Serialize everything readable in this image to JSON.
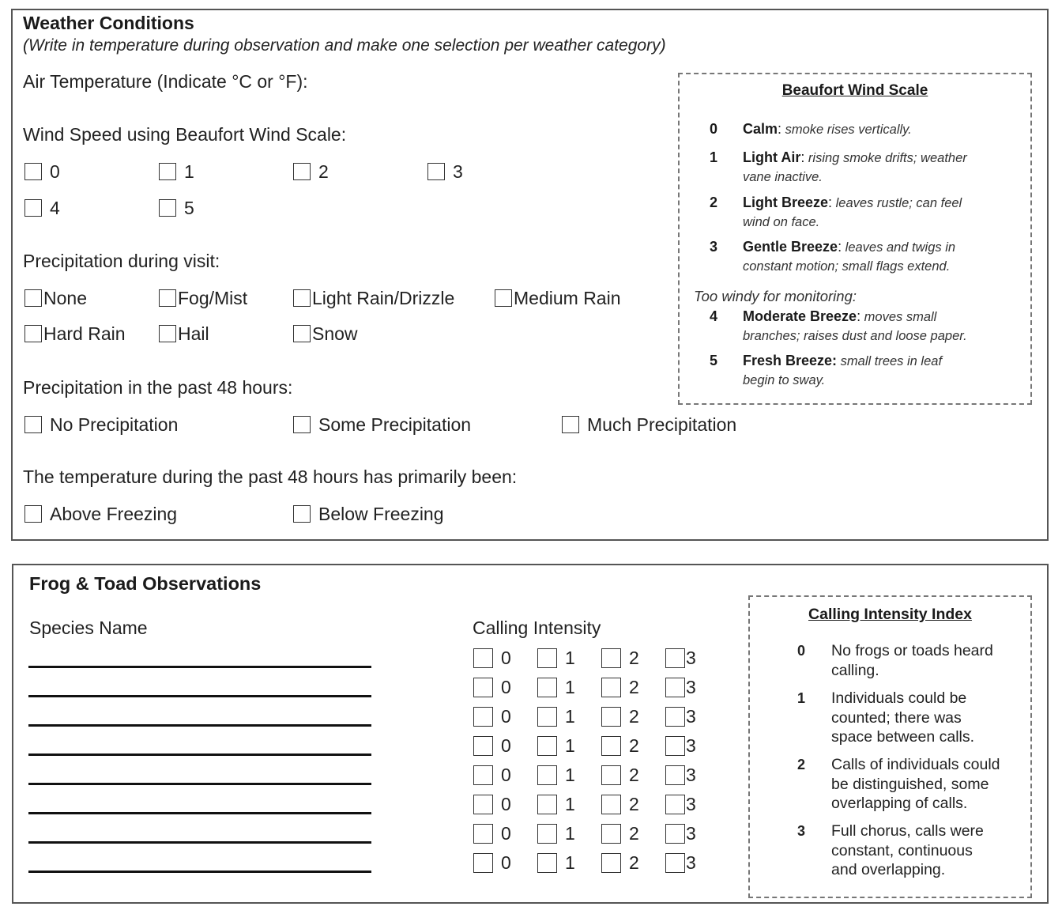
{
  "weather": {
    "title": "Weather Conditions",
    "instructions": "(Write in temperature during observation and make one selection per weather category)",
    "air_temperature": {
      "label": "Air Temperature (Indicate °C or °F):",
      "value": ""
    },
    "wind_speed": {
      "label": "Wind Speed using Beaufort Wind Scale:",
      "options": [
        "0",
        "1",
        "2",
        "3",
        "4",
        "5"
      ]
    },
    "precip_visit": {
      "label": "Precipitation during visit:",
      "options": [
        "None",
        "Fog/Mist",
        "Light Rain/Drizzle",
        "Medium Rain",
        "Hard Rain",
        "Hail",
        "Snow"
      ]
    },
    "precip_48h": {
      "label": "Precipitation in the past 48 hours:",
      "options": [
        "No Precipitation",
        "Some Precipitation",
        "Much Precipitation"
      ]
    },
    "temp_48h": {
      "label": "The temperature during the past 48 hours has primarily been:",
      "options": [
        "Above Freezing",
        "Below Freezing"
      ]
    },
    "beaufort_legend": {
      "title": "Beaufort Wind Scale",
      "too_windy_note": "Too windy for monitoring:",
      "entries": [
        {
          "num": "0",
          "name": "Calm",
          "sep": ":",
          "line1": " smoke rises vertically.",
          "line2": ""
        },
        {
          "num": "1",
          "name": "Light Air",
          "sep": ":",
          "line1": " rising smoke drifts; weather",
          "line2": "vane inactive."
        },
        {
          "num": "2",
          "name": "Light Breeze",
          "sep": ":",
          "line1": " leaves rustle; can feel",
          "line2": "wind on face."
        },
        {
          "num": "3",
          "name": "Gentle Breeze",
          "sep": ":",
          "line1": " leaves and twigs in",
          "line2": "constant motion; small flags extend."
        },
        {
          "num": "4",
          "name": "Moderate Breeze",
          "sep": ":",
          "line1": " moves small",
          "line2": "branches; raises dust and loose paper."
        },
        {
          "num": "5",
          "name": "Fresh Breeze:",
          "sep": "",
          "line1": " small trees in leaf",
          "line2": "begin to sway."
        }
      ]
    }
  },
  "frogs": {
    "title": "Frog & Toad Observations",
    "species_header": "Species Name",
    "intensity_header": "Calling Intensity",
    "rows": 8,
    "intensity_options": [
      "0",
      "1",
      "2",
      "3"
    ],
    "species_values": [
      "",
      "",
      "",
      "",
      "",
      "",
      "",
      ""
    ],
    "index_legend": {
      "title": "Calling Intensity Index",
      "entries": [
        {
          "num": "0",
          "lines": [
            "No frogs or toads heard",
            "calling."
          ]
        },
        {
          "num": "1",
          "lines": [
            "Individuals could be",
            "counted; there was",
            "space between calls."
          ]
        },
        {
          "num": "2",
          "lines": [
            "Calls of individuals could",
            "be distinguished, some",
            "overlapping of calls."
          ]
        },
        {
          "num": "3",
          "lines": [
            "Full chorus, calls were",
            "constant, continuous",
            "and overlapping."
          ]
        }
      ]
    }
  }
}
